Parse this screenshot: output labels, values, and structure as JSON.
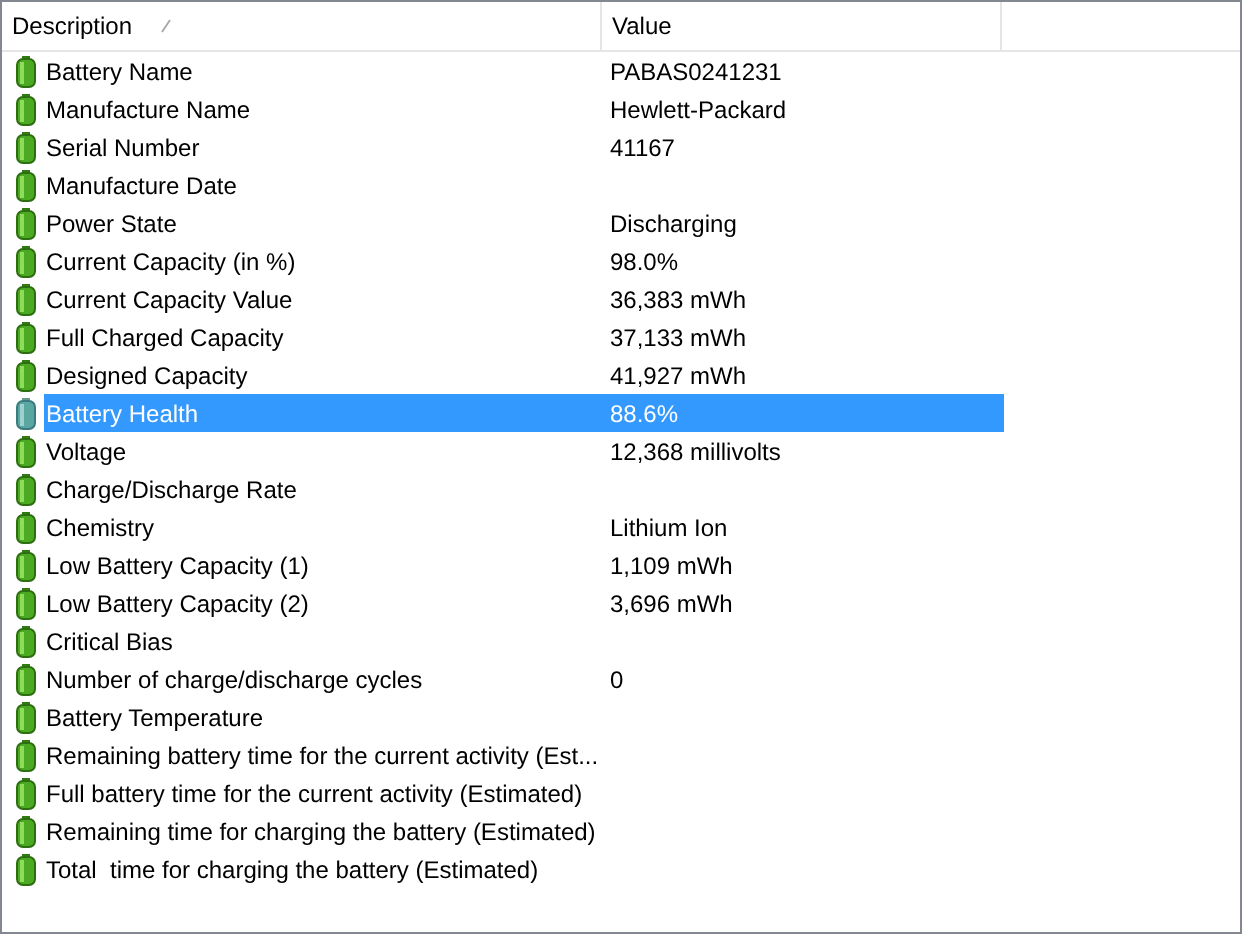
{
  "columns": [
    {
      "label": "Description",
      "sorted": true
    },
    {
      "label": "Value",
      "sorted": false
    }
  ],
  "rows": [
    {
      "description": "Battery Name",
      "value": "PABAS0241231",
      "selected": false
    },
    {
      "description": "Manufacture Name",
      "value": "Hewlett-Packard",
      "selected": false
    },
    {
      "description": "Serial Number",
      "value": "41167",
      "selected": false
    },
    {
      "description": "Manufacture Date",
      "selected": false
    },
    {
      "description": "Power State",
      "value": "Discharging",
      "selected": false
    },
    {
      "description": "Current Capacity (in %)",
      "value": "98.0%",
      "selected": false
    },
    {
      "description": "Current Capacity Value",
      "value": "36,383 mWh",
      "selected": false
    },
    {
      "description": "Full Charged Capacity",
      "value": "37,133 mWh",
      "selected": false
    },
    {
      "description": "Designed Capacity",
      "value": "41,927 mWh",
      "selected": false
    },
    {
      "description": "Battery Health",
      "value": "88.6%",
      "selected": true
    },
    {
      "description": "Voltage",
      "value": "12,368 millivolts",
      "selected": false
    },
    {
      "description": "Charge/Discharge Rate",
      "selected": false
    },
    {
      "description": "Chemistry",
      "value": "Lithium Ion",
      "selected": false
    },
    {
      "description": "Low Battery Capacity (1)",
      "value": "1,109 mWh",
      "selected": false
    },
    {
      "description": "Low Battery Capacity (2)",
      "value": "3,696 mWh",
      "selected": false
    },
    {
      "description": "Critical Bias",
      "selected": false
    },
    {
      "description": "Number of charge/discharge cycles",
      "value": "0",
      "selected": false
    },
    {
      "description": "Battery Temperature",
      "selected": false
    },
    {
      "description": "Remaining battery time for the current activity (Est...",
      "selected": false
    },
    {
      "description": "Full battery time for the current activity (Estimated)",
      "selected": false
    },
    {
      "description": "Remaining time for charging the battery (Estimated)",
      "selected": false
    },
    {
      "description": "Total  time for charging the battery (Estimated)",
      "selected": false
    }
  ]
}
